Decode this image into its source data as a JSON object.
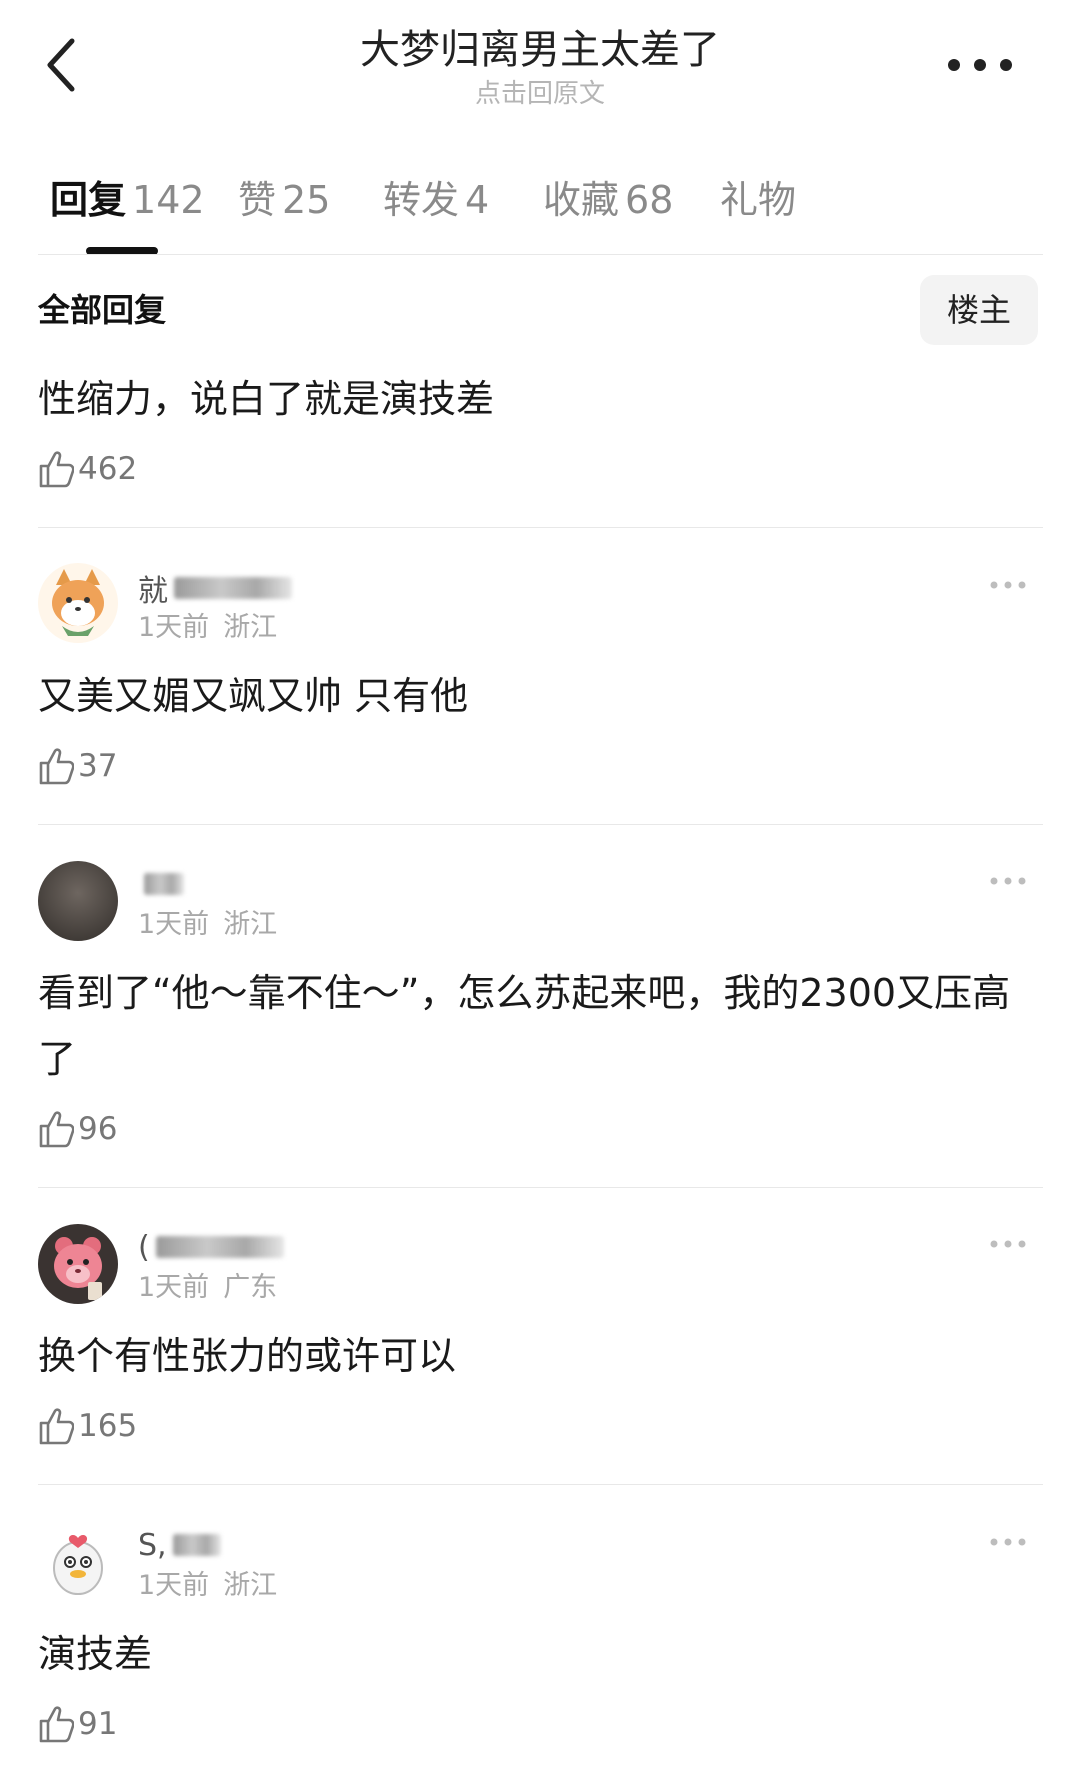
{
  "header": {
    "title": "大梦归离男主太差了",
    "subtitle": "点击回原文"
  },
  "tabs": [
    {
      "label": "回复",
      "count": "142",
      "active": true
    },
    {
      "label": "赞",
      "count": "25"
    },
    {
      "label": "转发",
      "count": "4"
    },
    {
      "label": "收藏",
      "count": "68"
    },
    {
      "label": "礼物",
      "count": ""
    }
  ],
  "section": {
    "title": "全部回复",
    "owner_filter": "楼主"
  },
  "top_comment": {
    "text": "性缩力，说白了就是演技差",
    "likes": "462"
  },
  "comments": [
    {
      "name": "就",
      "time": "1天前",
      "location": "浙江",
      "text": "又美又媚又飒又帅 只有他",
      "likes": "37",
      "avatar": "shiba-dog-avatar"
    },
    {
      "name": "",
      "time": "1天前",
      "location": "浙江",
      "text": "看到了“他～靠不住～”，怎么苏起来吧，我的2300又压高了",
      "likes": "96",
      "avatar": "dark-photo-avatar"
    },
    {
      "name": "(",
      "time": "1天前",
      "location": "广东",
      "text": "换个有性张力的或许可以",
      "likes": "165",
      "avatar": "strawberry-bear-avatar"
    },
    {
      "name": "S,",
      "time": "1天前",
      "location": "浙江",
      "text": "演技差",
      "likes": "91",
      "avatar": "cartoon-duck-avatar"
    }
  ],
  "colors": {
    "text_primary": "#1a1a1a",
    "text_secondary": "#8a8a8a",
    "meta": "#a8a8a8",
    "divider": "#e8e8e8",
    "chip_bg": "#f3f3f3"
  },
  "icons": {
    "back": "chevron-left-icon",
    "more": "more-horizontal-icon",
    "like": "thumbs-up-icon"
  }
}
